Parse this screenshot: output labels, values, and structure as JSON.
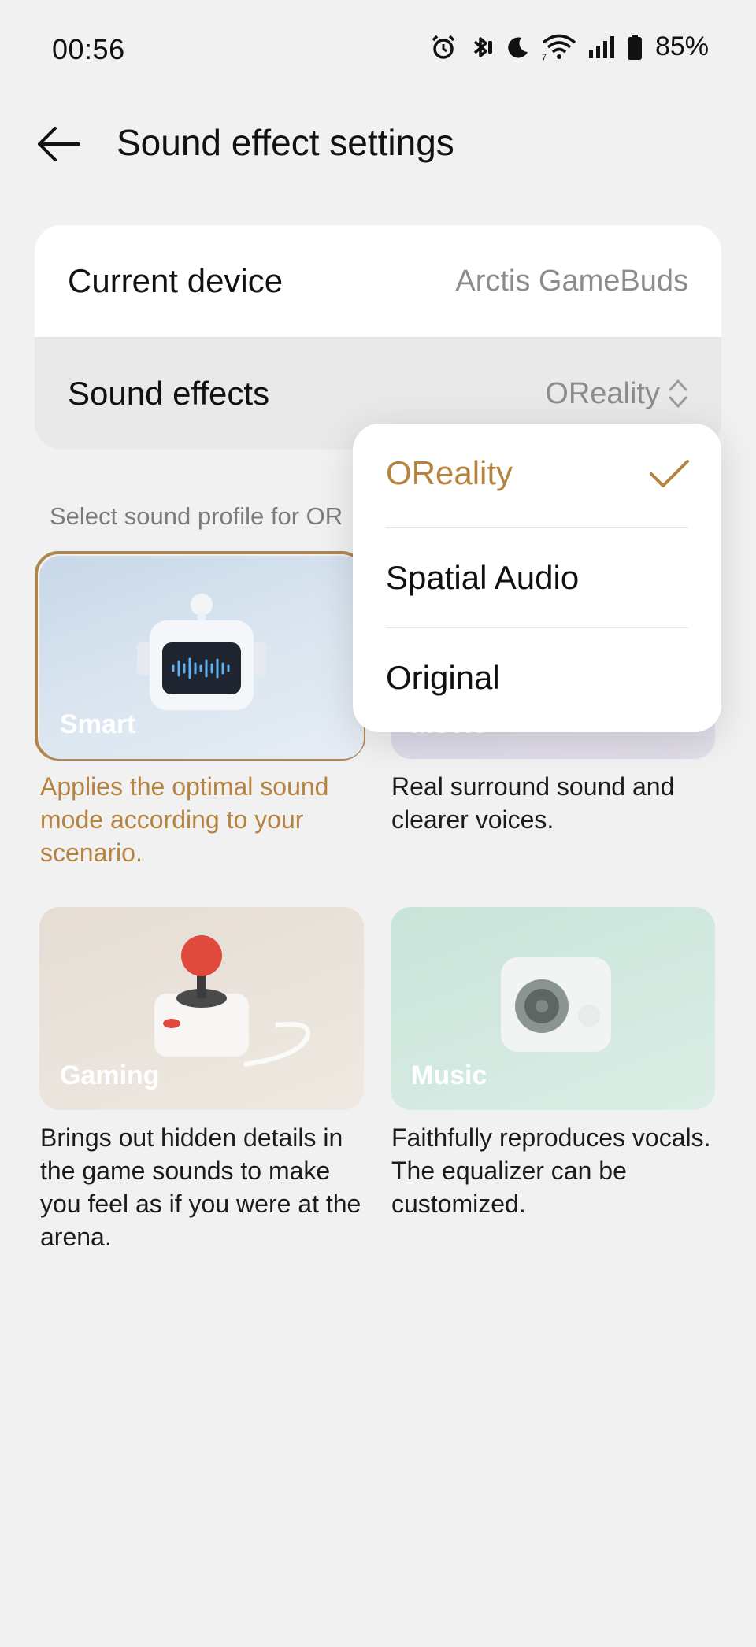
{
  "status_bar": {
    "time": "00:56",
    "battery_percent": "85%",
    "icons": [
      "alarm-icon",
      "bluetooth-icon",
      "do-not-disturb-icon",
      "wifi-icon",
      "signal-icon",
      "battery-icon"
    ]
  },
  "header": {
    "title": "Sound effect settings",
    "back_icon": "back-arrow-icon"
  },
  "settings": {
    "current_device_label": "Current device",
    "current_device_value": "Arctis GameBuds",
    "sound_effects_label": "Sound effects",
    "sound_effects_value": "OReality"
  },
  "section_hint": "Select sound profile for OR",
  "profiles": [
    {
      "label": "Smart",
      "description": "Applies the optimal sound mode according to your scenario.",
      "selected": true
    },
    {
      "label": "Movie",
      "description": "Real surround sound and clearer voices.",
      "selected": false
    },
    {
      "label": "Gaming",
      "description": "Brings out hidden details in the game sounds to make you feel as if you were at the arena.",
      "selected": false
    },
    {
      "label": "Music",
      "description": "Faithfully reproduces vocals. The equalizer can be customized.",
      "selected": false
    }
  ],
  "dropdown": {
    "options": [
      {
        "label": "OReality",
        "checked": true
      },
      {
        "label": "Spatial Audio",
        "checked": false
      },
      {
        "label": "Original",
        "checked": false
      }
    ]
  },
  "colors": {
    "accent": "#b5823f",
    "background": "#f1f1f1",
    "secondary_text": "#8c8c8c"
  }
}
